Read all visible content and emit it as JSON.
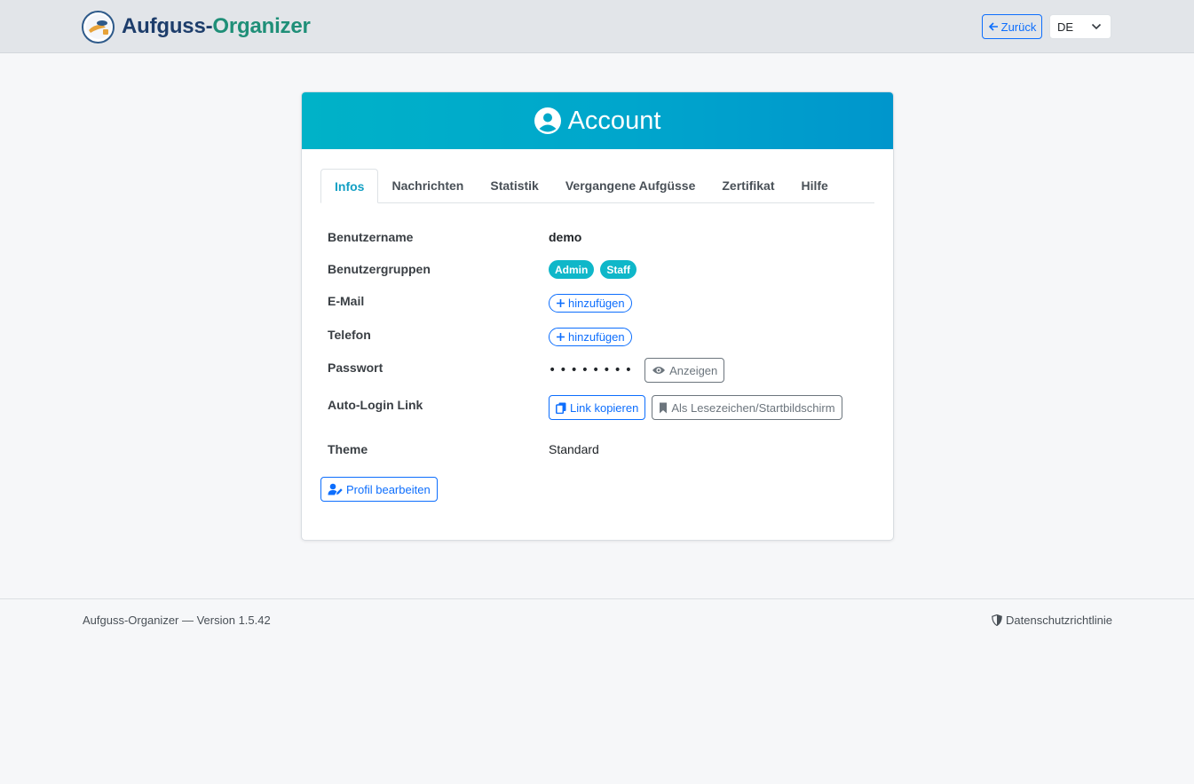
{
  "navbar": {
    "brand_part1": "Aufguss-",
    "brand_part2": "Organizer",
    "back_label": "Zurück",
    "language": "DE",
    "colors": {
      "brand_dark": "#1d3d6b",
      "brand_green": "#1f8f78",
      "link": "#0d6efd"
    }
  },
  "card": {
    "title": "Account",
    "header_gradient": [
      "#00b2c8",
      "#0096cc"
    ],
    "tabs": [
      {
        "label": "Infos",
        "active": true
      },
      {
        "label": "Nachrichten",
        "active": false
      },
      {
        "label": "Statistik",
        "active": false
      },
      {
        "label": "Vergangene Aufgüsse",
        "active": false
      },
      {
        "label": "Zertifikat",
        "active": false
      },
      {
        "label": "Hilfe",
        "active": false
      }
    ],
    "fields": {
      "username_label": "Benutzername",
      "username_value": "demo",
      "groups_label": "Benutzergruppen",
      "groups": [
        "Admin",
        "Staff"
      ],
      "email_label": "E-Mail",
      "email_add": "hinzufügen",
      "phone_label": "Telefon",
      "phone_add": "hinzufügen",
      "password_label": "Passwort",
      "password_mask": "••••••••",
      "password_show": "Anzeigen",
      "autologin_label": "Auto-Login Link",
      "copy_link": "Link kopieren",
      "bookmark": "Als Lesezeichen/Startbildschirm",
      "theme_label": "Theme",
      "theme_value": "Standard"
    },
    "edit_profile": "Profil bearbeiten"
  },
  "footer": {
    "version_text": "Aufguss-Organizer — Version 1.5.42",
    "privacy": "Datenschutzrichtlinie"
  }
}
